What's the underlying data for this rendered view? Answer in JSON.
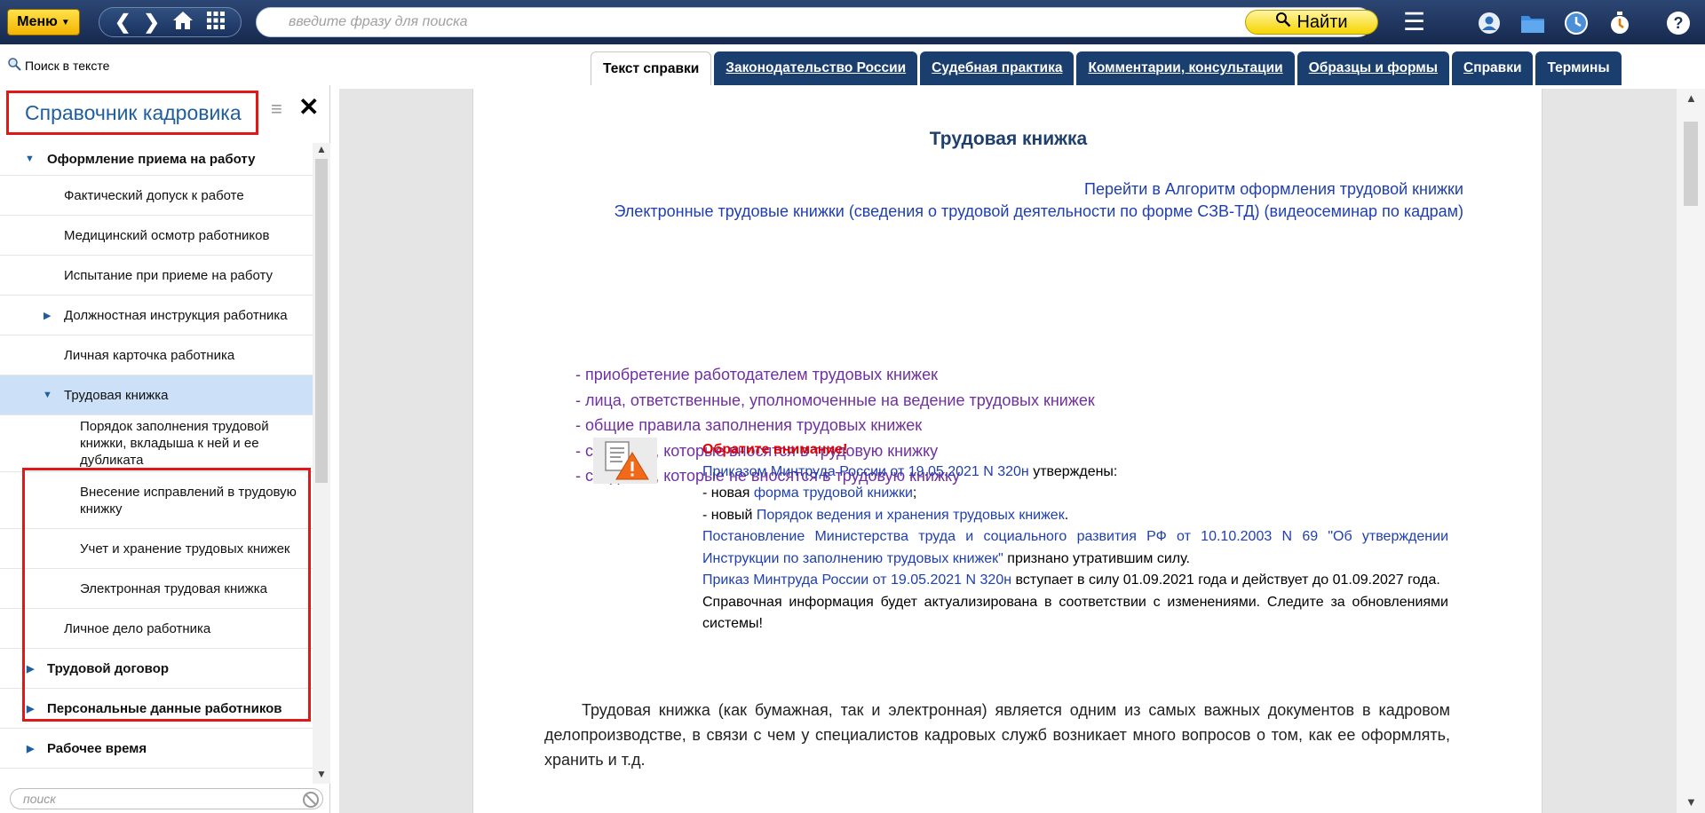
{
  "topbar": {
    "menu_label": "Меню",
    "search_placeholder": "введите фразу для поиска",
    "find_label": "Найти"
  },
  "tabbar": {
    "text_search": "Поиск в тексте",
    "tabs": [
      {
        "first": "",
        "rest": "Текст справки",
        "active": true
      },
      {
        "first": "З",
        "rest": "аконодательство России",
        "active": false
      },
      {
        "first": "С",
        "rest": "удебная практика",
        "active": false
      },
      {
        "first": "К",
        "rest": "омментарии, консультации",
        "active": false
      },
      {
        "first": "О",
        "rest": "бразцы и формы",
        "active": false
      },
      {
        "first": "С",
        "rest": "правки",
        "active": false
      },
      {
        "first": "",
        "rest": "Термины",
        "active": false
      }
    ]
  },
  "sidebar": {
    "title": "Справочник кадровика",
    "search_placeholder": "поиск",
    "items": [
      {
        "label": "Оформление приема на работу"
      },
      {
        "label": "Фактический допуск к работе"
      },
      {
        "label": "Медицинский осмотр работников"
      },
      {
        "label": "Испытание при приеме на работу"
      },
      {
        "label": "Должностная инструкция работника"
      },
      {
        "label": "Личная карточка работника"
      },
      {
        "label": "Трудовая книжка"
      },
      {
        "label": "Порядок заполнения трудовой книжки, вкладыша к ней и ее дубликата"
      },
      {
        "label": "Внесение исправлений в трудовую книжку"
      },
      {
        "label": "Учет и хранение трудовых книжек"
      },
      {
        "label": "Электронная трудовая книжка"
      },
      {
        "label": "Личное дело работника"
      },
      {
        "label": "Трудовой договор"
      },
      {
        "label": "Персональные данные работников"
      },
      {
        "label": "Рабочее время"
      }
    ]
  },
  "document": {
    "title": "Трудовая книжка",
    "link1": "Перейти в Алгоритм оформления трудовой книжки",
    "link2": "Электронные трудовые книжки (сведения о трудовой деятельности по форме СЗВ-ТД) (видеосеминар по кадрам)",
    "list_dash": "- ",
    "list": [
      "приобретение работодателем трудовых книжек",
      "лица, ответственные, уполномоченные на ведение трудовых книжек",
      "общие правила заполнения трудовых книжек",
      "сведения, которые вносятся в трудовую книжку",
      "сведения, которые не вносятся в трудовую книжку"
    ],
    "notice": {
      "heading": "Обратите внимание!",
      "line1_link": "Приказом Минтруда России от 19.05.2021 N 320н",
      "line1_rest": " утверждены:",
      "line2_pre": "- новая ",
      "line2_link": "форма трудовой книжки",
      "line2_post": ";",
      "line3_pre": "- новый ",
      "line3_link": "Порядок ведения и хранения трудовых книжек",
      "line3_post": ".",
      "line4_link": "Постановление Министерства труда и социального развития РФ от 10.10.2003 N 69 \"Об утверждении Инструкции по заполнению трудовых книжек\"",
      "line4_rest": " признано утратившим силу.",
      "line5_link": "Приказ Минтруда России от 19.05.2021 N 320н",
      "line5_rest": " вступает в силу 01.09.2021 года и действует до 01.09.2027 года.",
      "line6": "Справочная информация будет актуализирована в соответствии с изменениями. Следите за обновлениями системы!"
    },
    "paragraph": "Трудовая книжка (как бумажная, так и электронная) является одним из самых важных документов в кадровом делопроизводстве, в связи с чем у специалистов кадровых служб возникает много вопросов о том, как ее оформлять, хранить и т.д."
  },
  "colors": {
    "topbar": "#1d335c",
    "tab": "#1a3e6e",
    "accent_yellow": "#f5d400",
    "highlight_red": "#e01818",
    "link_blue": "#1f3fb0",
    "list_purple": "#7030a0",
    "selected_row": "#cce1f8"
  },
  "icons": [
    "back-arrow-icon",
    "forward-arrow-icon",
    "home-icon",
    "grid-icon",
    "search-icon",
    "hamburger-icon",
    "user-icon",
    "folder-icon",
    "clock-icon",
    "stopwatch-icon",
    "help-icon",
    "document-warning-icon",
    "close-icon",
    "tree-menu-icon"
  ]
}
